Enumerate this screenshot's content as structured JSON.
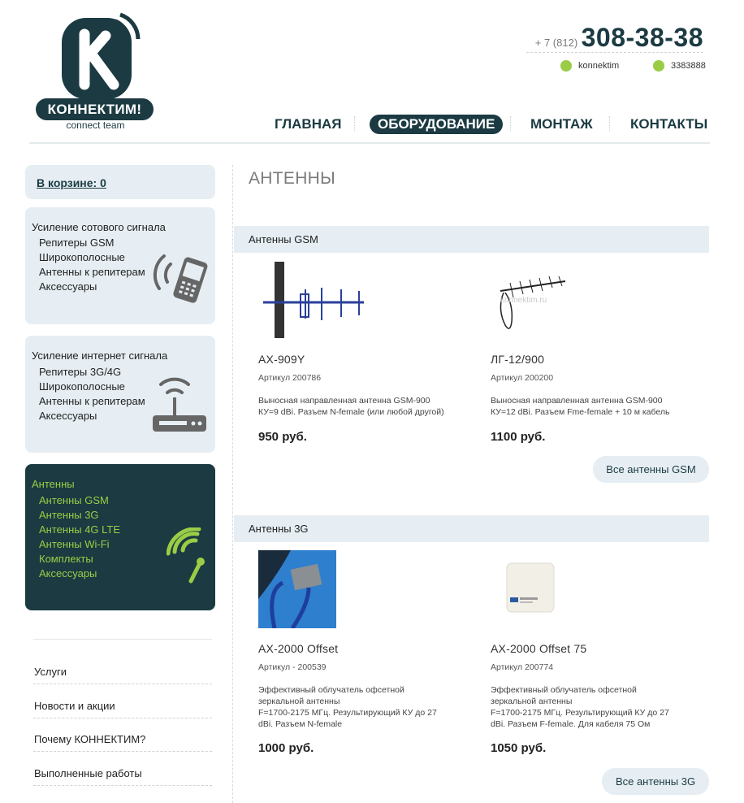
{
  "header": {
    "logo_word": "КОННЕКТИМ!",
    "logo_sub": "connect team",
    "phone_prefix": "+ 7 (812)",
    "phone_number": "308-38-38",
    "skype": "konnektim",
    "icq": "3383888"
  },
  "nav": [
    "ГЛАВНАЯ",
    "ОБОРУДОВАНИЕ",
    "МОНТАЖ",
    "КОНТАКТЫ"
  ],
  "cart": "В корзине: 0",
  "sidebar": {
    "cell": {
      "title": "Усиление сотового сигнала",
      "items": [
        "Репитеры GSM",
        "Широкополосные",
        "Антенны к репитерам",
        "Аксессуары"
      ]
    },
    "inet": {
      "title": "Усиление интернет сигнала",
      "items": [
        "Репитеры 3G/4G",
        "Широкополосные",
        "Антенны к репитерам",
        "Аксессуары"
      ]
    },
    "ant": {
      "title": "Антенны",
      "items": [
        "Антенны GSM",
        "Антенны 3G",
        "Антенны 4G LTE",
        "Антенны Wi-Fi",
        "Комплекты",
        "Аксессуары"
      ]
    },
    "links": [
      "Услуги",
      "Новости и акции",
      "Почему КОННЕКТИМ?",
      "Выполненные работы"
    ]
  },
  "page_title": "АНТЕННЫ",
  "sections": [
    {
      "title": "Антенны GSM",
      "products": [
        {
          "name": "AX-909Y",
          "article": "Артикул 200786",
          "desc": [
            "Выносная направленная антенна GSM-900",
            "КУ=9 dBi. Разъем N-female (или любой другой)"
          ],
          "price": "950 руб."
        },
        {
          "name": "ЛГ-12/900",
          "article": "Артикул 200200",
          "desc": [
            "Выносная направленная антенна GSM-900",
            "КУ=12 dBi. Разъем Fme-female + 10 м кабель"
          ],
          "price": "1100 руб.",
          "img_text": "konnektim.ru"
        }
      ],
      "more": "Все антенны GSM"
    },
    {
      "title": "Антенны 3G",
      "products": [
        {
          "name": "AX-2000 Offset",
          "article": "Артикул - 200539",
          "desc": [
            "Эффективный облучатель офсетной",
            "зеркальной антенны",
            "F=1700-2175 МГц. Результирующий КУ до 27",
            "dBi. Разъем N-female"
          ],
          "price": "1000 руб."
        },
        {
          "name": "AX-2000 Offset 75",
          "article": "Артикул 200774",
          "desc": [
            "Эффективный облучатель офсетной",
            "зеркальной антенны",
            "F=1700-2175 МГц. Результирующий КУ до 27",
            "dBi. Разъем F-female. Для кабеля 75 Ом"
          ],
          "price": "1050 руб."
        }
      ],
      "more": "Все антенны 3G"
    }
  ],
  "colors": {
    "brand": "#1b3a42",
    "accent": "#9acd45",
    "panel": "#e6eef3"
  }
}
